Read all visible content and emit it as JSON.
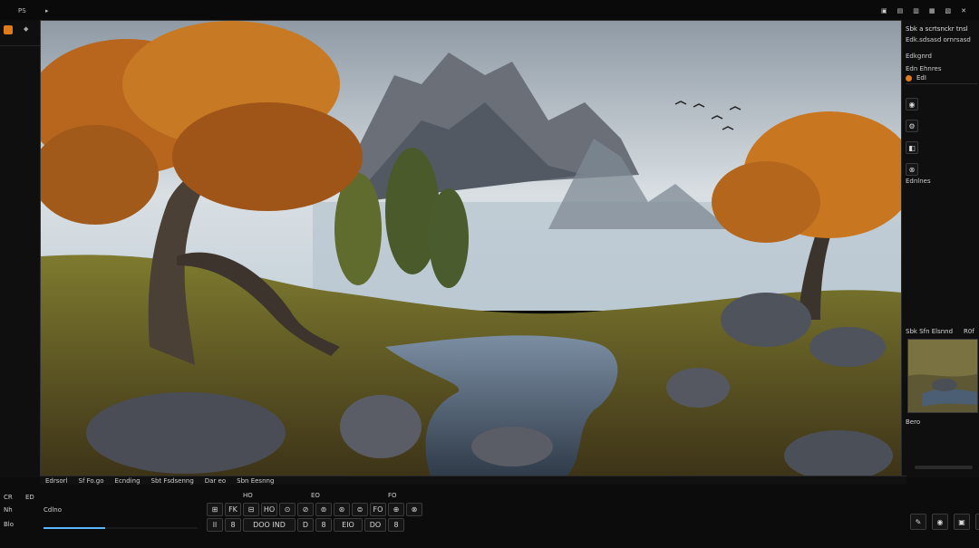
{
  "menu": {
    "item1": "PS",
    "item2": "▸"
  },
  "top_right_icons": [
    "window-icon",
    "dock-icon",
    "split-icon",
    "minimize-icon",
    "maximize-icon",
    "close-icon"
  ],
  "left_panel": {
    "label": "◆",
    "corner_icon": "brand-icon"
  },
  "right_panel": {
    "header": "Sbk a scrtsnckr tnsl",
    "subheader": "Edk.sdsasd ornrsasd",
    "section1": "Edkgnrd",
    "section2": "Edn Ehnres",
    "layer_label": "EdI",
    "section3": "Ednlnes",
    "preview_header": "Sbk Sfn Elsnnd",
    "preview_header2": "R0f",
    "preview_footer": "Bero"
  },
  "status_bar": {
    "items": [
      "Edrsorl",
      "Sf Fo.go",
      "Ecnding",
      "Sbt Fsdsenng",
      "Dar eo",
      "Sbn Eesnng"
    ]
  },
  "bottom_toolbar": {
    "left_labels": [
      "CR",
      "ED",
      "Nh",
      "Blo"
    ],
    "timeline_label": "Cdlno",
    "row1": [
      "⊞",
      "FK",
      "⊟",
      "HO",
      "⊙",
      "⊘",
      "⊚",
      "⊛",
      "⊜",
      "FO",
      "⊕",
      "⊗"
    ],
    "row2": [
      "ll",
      "8",
      "DOO IND",
      "D",
      "8",
      "EIO",
      "DO",
      "8"
    ],
    "misc_labels": [
      "HO",
      "FO",
      "EO"
    ]
  },
  "bottom_right_tools": [
    "brush-icon",
    "record-icon",
    "camera-icon",
    "shield-icon"
  ],
  "colors": {
    "accent": "#e07a1a",
    "background": "#0c0c0c",
    "panel": "#0f0f0f",
    "timeline_bar": "#5ab6ff"
  }
}
